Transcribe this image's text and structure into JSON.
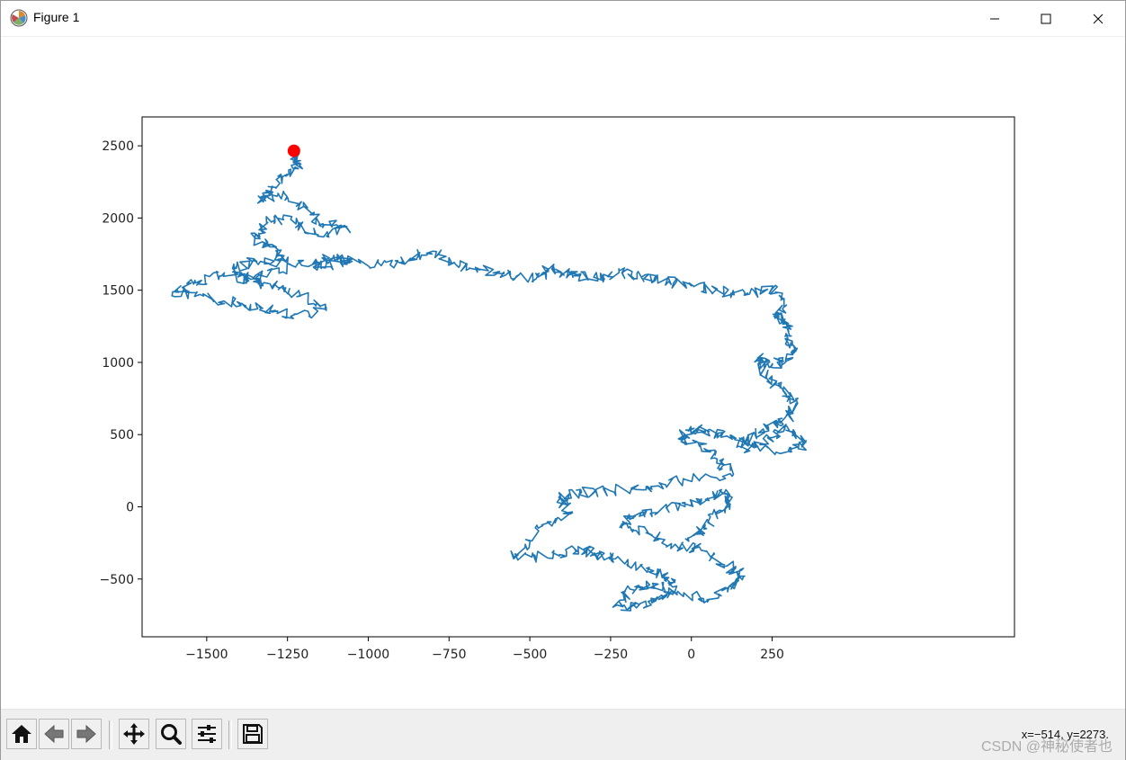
{
  "window": {
    "title": "Figure 1"
  },
  "toolbar": {
    "buttons": [
      {
        "icon": "home-icon"
      },
      {
        "icon": "back-arrow-icon"
      },
      {
        "icon": "forward-arrow-icon"
      },
      {
        "icon": "pan-move-icon"
      },
      {
        "icon": "zoom-magnifier-icon"
      },
      {
        "icon": "configure-subplots-icon"
      },
      {
        "icon": "save-floppy-icon"
      }
    ],
    "coordinates": "x=−514, y=2273.",
    "watermark": "CSDN @神秘使者也"
  },
  "colors": {
    "walk_line": "#1f77b4",
    "start_marker": "#ff0000",
    "axes": "#000000",
    "background": "#ffffff"
  },
  "chart_data": {
    "type": "line",
    "title": "",
    "xlabel": "",
    "ylabel": "",
    "xlim": [
      -1700,
      1000
    ],
    "ylim": [
      -900,
      2700
    ],
    "grid": false,
    "legend": "none",
    "xticks": [
      -1500,
      -1250,
      -1000,
      -750,
      -500,
      -250,
      0,
      250
    ],
    "xtick_labels": [
      "−1500",
      "−1250",
      "−1000",
      "−750",
      "−500",
      "−250",
      "0",
      "250"
    ],
    "yticks": [
      -500,
      0,
      500,
      1000,
      1500,
      2000,
      2500
    ],
    "ytick_labels": [
      "−500",
      "0",
      "500",
      "1000",
      "1500",
      "2000",
      "2500"
    ],
    "series": [
      {
        "kind": "random-walk",
        "x": [
          -1235,
          -1215,
          -1255,
          -1300,
          -1330,
          -1280,
          -1200,
          -1140,
          -1065,
          -1165,
          -1240,
          -1315,
          -1350,
          -1305,
          -1250,
          -1345,
          -1420,
          -1385,
          -1330,
          -1460,
          -1535,
          -1605,
          -1510,
          -1420,
          -1330,
          -1240,
          -1130,
          -1210,
          -1280,
          -1350,
          -1225,
          -1110,
          -1050,
          -1170,
          -1095,
          -960,
          -870,
          -800,
          -730,
          -655,
          -560,
          -480,
          -445,
          -400,
          -345,
          -280,
          -215,
          -155,
          -70,
          0,
          80,
          165,
          250,
          285,
          255,
          300,
          290,
          320,
          295,
          250,
          205,
          230,
          280,
          320,
          305,
          255,
          200,
          145,
          305,
          350,
          295,
          250,
          180,
          110,
          45,
          0,
          -40,
          25,
          80,
          120,
          -40,
          -140,
          -250,
          -340,
          -410,
          -375,
          -460,
          -550,
          -455,
          -360,
          -300,
          -235,
          -130,
          -70,
          -60,
          -110,
          -170,
          -230,
          -190,
          -120,
          -45,
          55,
          120,
          165,
          110,
          30,
          -50,
          -140,
          -215,
          -180,
          -105,
          -20,
          50,
          100,
          120,
          75,
          40,
          -10
        ],
        "y": [
          2460,
          2375,
          2290,
          2210,
          2130,
          2170,
          2080,
          1960,
          1930,
          1890,
          1990,
          1980,
          1860,
          1800,
          1690,
          1700,
          1650,
          1590,
          1540,
          1600,
          1550,
          1490,
          1460,
          1410,
          1380,
          1320,
          1360,
          1460,
          1520,
          1600,
          1660,
          1720,
          1700,
          1660,
          1720,
          1670,
          1720,
          1770,
          1680,
          1640,
          1610,
          1580,
          1650,
          1620,
          1600,
          1580,
          1620,
          1590,
          1560,
          1530,
          1500,
          1470,
          1510,
          1380,
          1320,
          1270,
          1180,
          1090,
          1010,
          980,
          1030,
          900,
          820,
          730,
          620,
          580,
          500,
          420,
          380,
          440,
          560,
          480,
          430,
          490,
          530,
          540,
          470,
          420,
          330,
          230,
          180,
          140,
          110,
          100,
          70,
          -40,
          -130,
          -360,
          -340,
          -300,
          -320,
          -360,
          -420,
          -490,
          -580,
          -650,
          -700,
          -680,
          -570,
          -530,
          -600,
          -640,
          -550,
          -480,
          -410,
          -300,
          -260,
          -180,
          -120,
          -80,
          -40,
          30,
          60,
          90,
          20,
          -40,
          -150,
          -210
        ]
      },
      {
        "kind": "start-marker",
        "x": [
          -1230
        ],
        "y": [
          2465
        ]
      }
    ]
  }
}
